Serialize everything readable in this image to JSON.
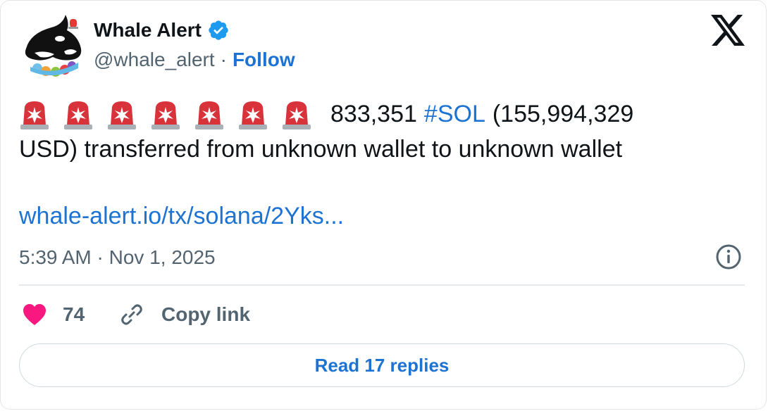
{
  "author": {
    "display_name": "Whale Alert",
    "handle": "@whale_alert",
    "separator": "·",
    "follow_label": "Follow",
    "verified": true,
    "verified_color": "#1d9bf0"
  },
  "icons": {
    "siren": "police-car-light-icon",
    "siren_count": 7,
    "platform": "x-logo-icon",
    "info": "info-icon",
    "like": "heart-icon",
    "copy": "link-icon"
  },
  "tweet": {
    "amount": "833,351",
    "hashtag": "#SOL",
    "line1_rest": "(155,994,329",
    "line2": "USD) transferred from unknown wallet to unknown wallet",
    "link": "whale-alert.io/tx/solana/2Yks...",
    "time": "5:39 AM",
    "date_separator": "·",
    "date": "Nov 1, 2025"
  },
  "actions": {
    "like_count": "74",
    "copy_link_label": "Copy link",
    "read_replies_label": "Read 17 replies"
  },
  "colors": {
    "accent": "#1d73d3",
    "heart": "#f91880",
    "secondary_text": "#536471",
    "siren_red": "#d8323b"
  }
}
